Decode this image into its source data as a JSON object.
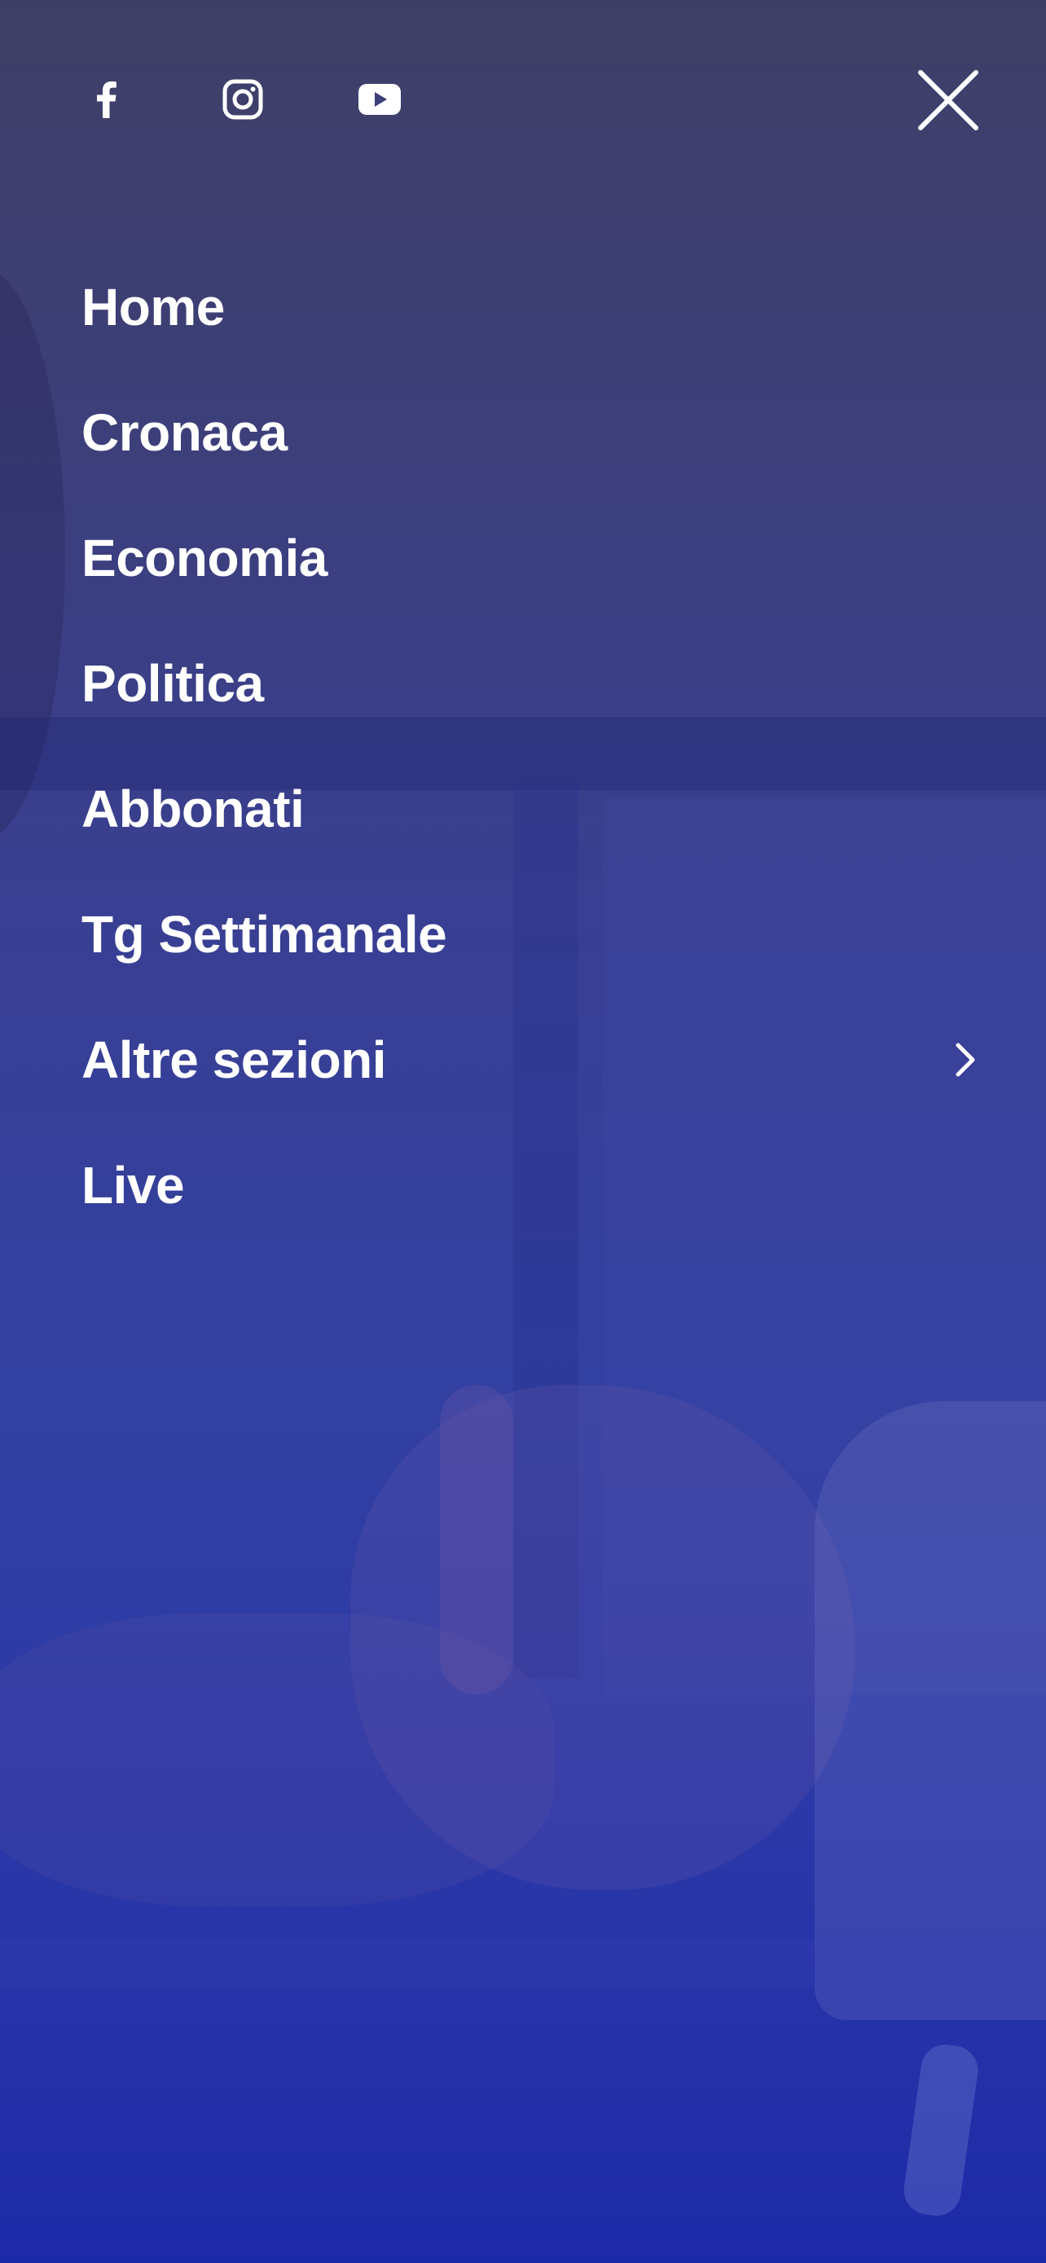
{
  "colors": {
    "text": "#ffffff",
    "overlay_top": "#3f3f66",
    "overlay_bottom": "#1d2aa8"
  },
  "social": [
    {
      "name": "facebook",
      "icon": "facebook-icon"
    },
    {
      "name": "instagram",
      "icon": "instagram-icon"
    },
    {
      "name": "youtube",
      "icon": "youtube-icon"
    }
  ],
  "close": {
    "icon": "close-icon"
  },
  "menu": {
    "items": [
      {
        "label": "Home"
      },
      {
        "label": "Cronaca"
      },
      {
        "label": "Economia"
      },
      {
        "label": "Politica"
      },
      {
        "label": "Abbonati"
      },
      {
        "label": "Tg Settimanale"
      },
      {
        "label": "Altre sezioni",
        "has_submenu": true,
        "icon": "chevron-right-icon"
      },
      {
        "label": "Live"
      }
    ]
  }
}
